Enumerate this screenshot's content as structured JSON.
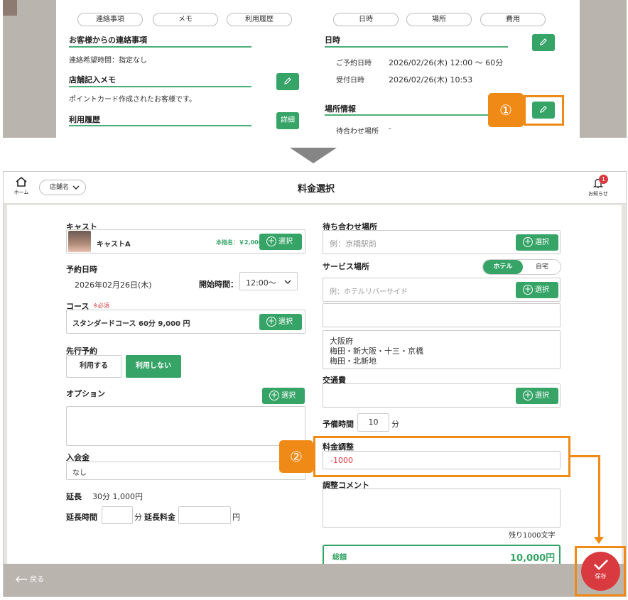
{
  "top_screenshot": {
    "tabs_left": [
      "連絡事項",
      "メモ",
      "利用履歴"
    ],
    "tabs_right": [
      "日時",
      "場所",
      "費用"
    ],
    "contact_title": "お客様からの連絡事項",
    "contact_text": "連絡希望時間：指定なし",
    "store_note_title": "店舗記入メモ",
    "store_note_text": "ポイントカード作成されたお客様です。",
    "history_title": "利用履歴",
    "detail_button": "詳細",
    "datetime_title": "日時",
    "reserve_label": "ご予約日時",
    "reserve_value": "2026/02/26(木) 12:00 〜 60分",
    "received_label": "受付日時",
    "received_value": "2026/02/26(木) 10:53",
    "location_title": "場所情報",
    "meeting_label": "待合わせ場所",
    "meeting_value": "-",
    "marker1": "①"
  },
  "header": {
    "home_label": "ホーム",
    "store_select": "店舗名",
    "title": "料金選択",
    "notification_label": "お知らせ",
    "notification_count": "1"
  },
  "left": {
    "cast_label": "キャスト",
    "cast_name": "キャストA",
    "cast_fee": "本指名：￥2,000",
    "select_label": "選択",
    "date_label": "予約日時",
    "date_value": "2026年02月26日(木)",
    "start_time_label": "開始時間：",
    "start_time_value": "12:00〜",
    "course_label": "コース",
    "course_required": "※必須",
    "course_value": "スタンダードコース 60分 9,000 円",
    "advance_label": "先行予約",
    "advance_use": "利用する",
    "advance_nouse": "利用しない",
    "option_label": "オプション",
    "membership_label": "入会金",
    "membership_value": "なし",
    "extension_label": "延長",
    "extension_value": "30分 1,000円",
    "extension_time_label": "延長時間",
    "extension_unit": "分",
    "extension_fee_label": "延長料金",
    "extension_fee_unit": "円"
  },
  "right": {
    "meeting_label": "待ち合わせ場所",
    "meeting_placeholder": "例：京橋駅前",
    "service_label": "サービス場所",
    "toggle_hotel": "ホテル",
    "toggle_home": "自宅",
    "hotel_placeholder": "例：ホテルリバーサイド",
    "area_text_1": "大阪府",
    "area_text_2": "梅田・新大阪・十三・京橋",
    "area_text_3": "梅田・北新地",
    "transport_label": "交通費",
    "spare_label": "予備時間",
    "spare_value": "10",
    "spare_unit": "分",
    "adjust_label": "料金調整",
    "adjust_value": "-1000",
    "comment_label": "調整コメント",
    "remaining": "残り1000文字",
    "total_label": "総額",
    "total_value": "10,000円",
    "marker2": "②"
  },
  "footer": {
    "back_label": "戻る",
    "save_label": "保存"
  },
  "colors": {
    "accent_green": "#35a466",
    "highlight_orange": "#f08a16",
    "save_red": "#d93a3f"
  }
}
